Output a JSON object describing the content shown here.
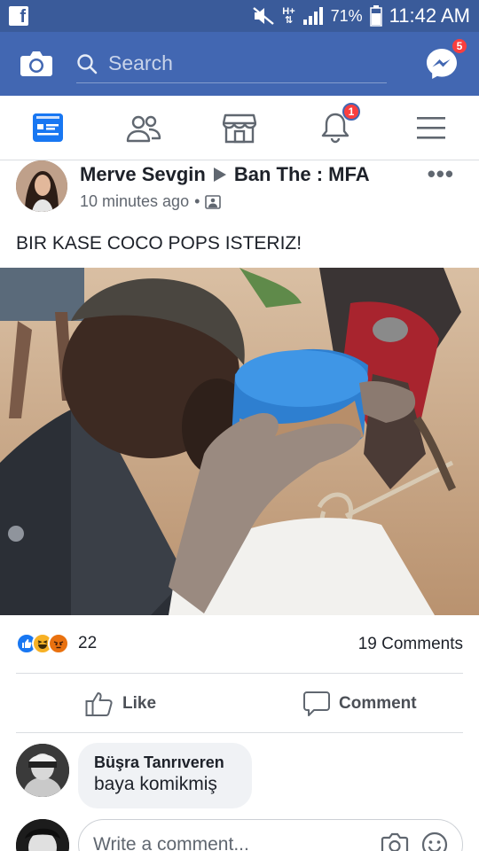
{
  "status_bar": {
    "battery": "71%",
    "time": "11:42 AM",
    "network": "H+"
  },
  "app_bar": {
    "search_placeholder": "Search",
    "messenger_badge": "5"
  },
  "nav": {
    "notifications_badge": "1",
    "tabs": [
      "news-feed",
      "friends",
      "marketplace",
      "notifications",
      "menu"
    ]
  },
  "post": {
    "author": "Merve Sevgin",
    "group": "Ban The : MFA",
    "time": "10 minutes ago",
    "text": "BIR KASE COCO POPS ISTERIZ!",
    "reactions": [
      "like",
      "haha",
      "angry"
    ],
    "reaction_count": "22",
    "comments_count": "19 Comments",
    "like_label": "Like",
    "comment_label": "Comment"
  },
  "comment": {
    "name": "Büşra Tanrıveren",
    "text": "baya komikmiş"
  },
  "composer": {
    "placeholder": "Write a comment..."
  },
  "colors": {
    "facebook_blue": "#4267b2",
    "status_bar": "#3a5b9a",
    "badge_red": "#fa3e3e",
    "active_tab": "#1877f2"
  }
}
